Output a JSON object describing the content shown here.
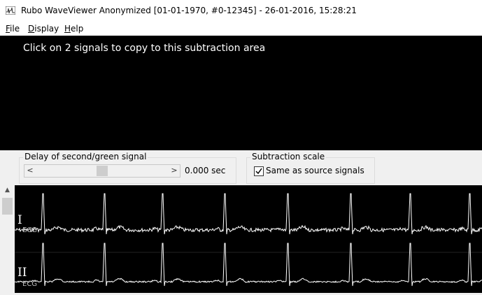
{
  "window": {
    "title": "Rubo WaveViewer    Anonymized [01-01-1970, #0-12345]    -    26-01-2016, 15:28:21"
  },
  "menu": {
    "items": [
      {
        "label": "File"
      },
      {
        "label": "Display"
      },
      {
        "label": "Help"
      }
    ]
  },
  "subtraction_area": {
    "hint": "Click on 2 signals to copy to this subtraction area"
  },
  "delay": {
    "group_label": "Delay of second/green signal",
    "value_text": "0.000 sec",
    "slider_fraction": 0.5
  },
  "scale": {
    "group_label": "Subtraction scale",
    "checkbox_label": "Same as source signals",
    "checked": true
  },
  "leads": [
    {
      "label": "I",
      "type": "ECG"
    },
    {
      "label": "II",
      "type": "ECG"
    }
  ]
}
